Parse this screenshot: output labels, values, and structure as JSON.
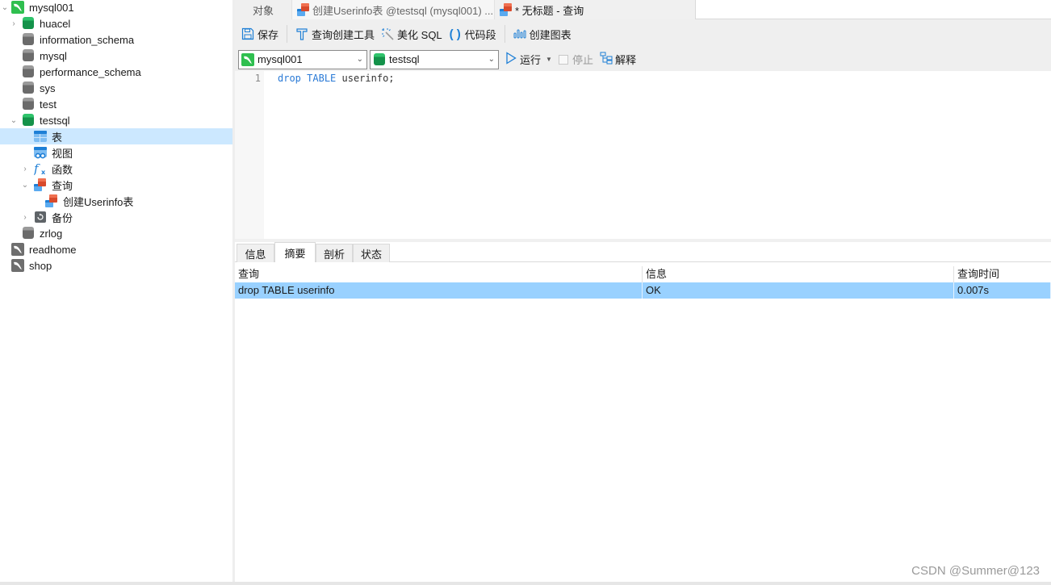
{
  "sidebar": {
    "items": [
      {
        "label": "mysql001",
        "icon": "mysql-connection-icon",
        "state": "expanded",
        "level": 0
      },
      {
        "label": "huacel",
        "icon": "database-open-icon",
        "state": "collapsed",
        "level": 1
      },
      {
        "label": "information_schema",
        "icon": "database-closed-icon",
        "level": 1
      },
      {
        "label": "mysql",
        "icon": "database-closed-icon",
        "level": 1
      },
      {
        "label": "performance_schema",
        "icon": "database-closed-icon",
        "level": 1
      },
      {
        "label": "sys",
        "icon": "database-closed-icon",
        "level": 1
      },
      {
        "label": "test",
        "icon": "database-closed-icon",
        "level": 1
      },
      {
        "label": "testsql",
        "icon": "database-open-icon",
        "state": "expanded",
        "level": 1
      },
      {
        "label": "表",
        "icon": "table-icon",
        "level": 2,
        "selected": true
      },
      {
        "label": "视图",
        "icon": "view-icon",
        "level": 2
      },
      {
        "label": "函数",
        "icon": "function-icon",
        "state": "collapsed",
        "level": 2
      },
      {
        "label": "查询",
        "icon": "query-icon",
        "state": "expanded",
        "level": 2
      },
      {
        "label": "创建Userinfo表",
        "icon": "query-icon",
        "level": 3
      },
      {
        "label": "备份",
        "icon": "backup-icon",
        "state": "collapsed",
        "level": 2
      },
      {
        "label": "zrlog",
        "icon": "database-closed-icon",
        "level": 1
      },
      {
        "label": "readhome",
        "icon": "mysql-connection-closed-icon",
        "level": 0
      },
      {
        "label": "shop",
        "icon": "mysql-connection-closed-icon",
        "level": 0
      }
    ]
  },
  "tabs": {
    "objects": "对象",
    "create_userinfo": "创建Userinfo表 @testsql (mysql001) ...",
    "untitled": "* 无标题 - 查询"
  },
  "toolbar": {
    "save": "保存",
    "query_builder": "查询创建工具",
    "beautify_sql": "美化 SQL",
    "code_snippet": "代码段",
    "create_chart": "创建图表"
  },
  "connbar": {
    "connection": "mysql001",
    "database": "testsql",
    "run": "运行",
    "stop": "停止",
    "explain": "解释"
  },
  "editor": {
    "line_number": "1",
    "code": {
      "kw1": "drop",
      "kw2": "TABLE",
      "rest": " userinfo;"
    }
  },
  "result_tabs": [
    "信息",
    "摘要",
    "剖析",
    "状态"
  ],
  "result_tabs_active": "摘要",
  "result_table": {
    "columns": [
      "查询",
      "信息",
      "查询时间"
    ],
    "rows": [
      [
        "drop TABLE userinfo",
        "OK",
        "0.007s"
      ]
    ]
  },
  "watermark": "CSDN @Summer@123"
}
